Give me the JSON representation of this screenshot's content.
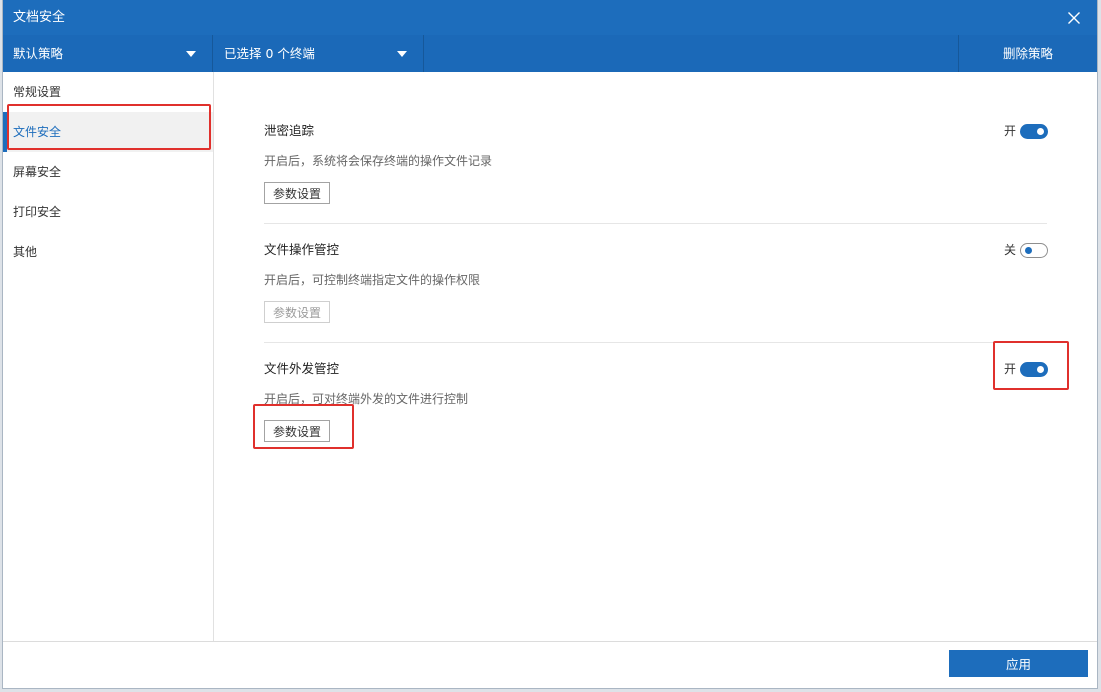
{
  "window": {
    "title": "文档安全",
    "close_icon": "close-icon"
  },
  "toolbar": {
    "policy_dropdown": {
      "label": "默认策略",
      "icon": "caret-down-icon"
    },
    "terminal_dropdown": {
      "label": "已选择 0 个终端",
      "icon": "caret-down-icon"
    },
    "delete_policy_label": "删除策略"
  },
  "sidebar": {
    "items": [
      {
        "label": "常规设置",
        "selected": false
      },
      {
        "label": "文件安全",
        "selected": true
      },
      {
        "label": "屏幕安全",
        "selected": false
      },
      {
        "label": "打印安全",
        "selected": false
      },
      {
        "label": "其他",
        "selected": false
      }
    ]
  },
  "sections": [
    {
      "title": "泄密追踪",
      "description": "开启后，系统将会保存终端的操作文件记录",
      "toggle": {
        "on": true,
        "label": "开"
      },
      "settings_button": {
        "label": "参数设置",
        "enabled": true
      }
    },
    {
      "title": "文件操作管控",
      "description": "开启后，可控制终端指定文件的操作权限",
      "toggle": {
        "on": false,
        "label": "关"
      },
      "settings_button": {
        "label": "参数设置",
        "enabled": false
      }
    },
    {
      "title": "文件外发管控",
      "description": "开启后，可对终端外发的文件进行控制",
      "toggle": {
        "on": true,
        "label": "开"
      },
      "settings_button": {
        "label": "参数设置",
        "enabled": true
      }
    }
  ],
  "footer": {
    "apply_label": "应用"
  },
  "colors": {
    "accent": "#1d6dbc",
    "toolbar": "#1b69b8",
    "highlight": "#e0302c"
  }
}
